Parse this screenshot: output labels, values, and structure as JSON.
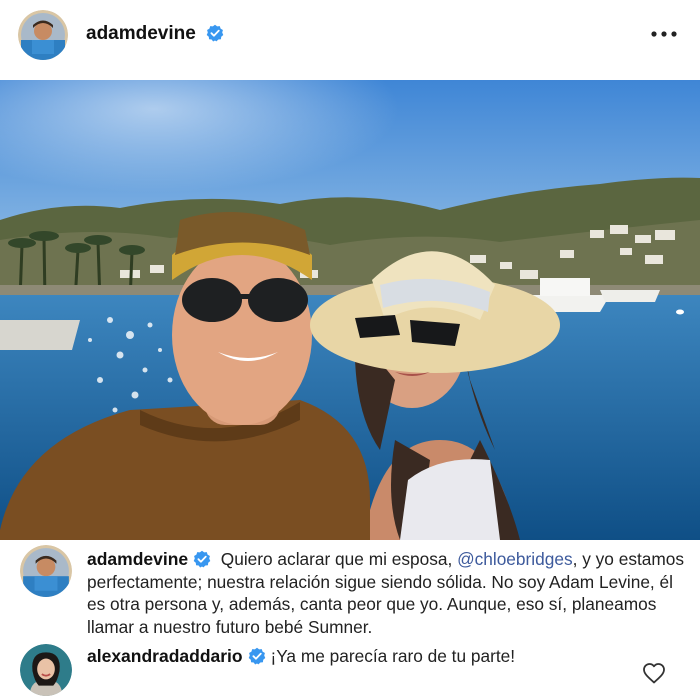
{
  "post": {
    "username": "adamdevine",
    "verified": true,
    "menu_icon": "more-horizontal-icon"
  },
  "photo": {
    "icon": "selfie-photo"
  },
  "comments": [
    {
      "username": "adamdevine",
      "verified": true,
      "text_before": "Quiero aclarar que mi esposa, ",
      "mention": "@chloebridges",
      "text_after": ", y yo estamos perfectamente; nuestra relación sigue siendo sólida. No soy Adam Levine, él es otra persona y, además, canta peor que yo. Aunque, eso sí, planeamos llamar a nuestro futuro bebé Sumner."
    },
    {
      "username": "alexandradaddario",
      "verified": true,
      "text": "¡Ya me parecía raro de tu parte!",
      "like_icon": "heart-outline-icon"
    }
  ],
  "colors": {
    "verified_badge": "#3897f0",
    "mention": "#3d5a9c",
    "sky": "#4f8fd6",
    "water": "#1c5f94"
  }
}
